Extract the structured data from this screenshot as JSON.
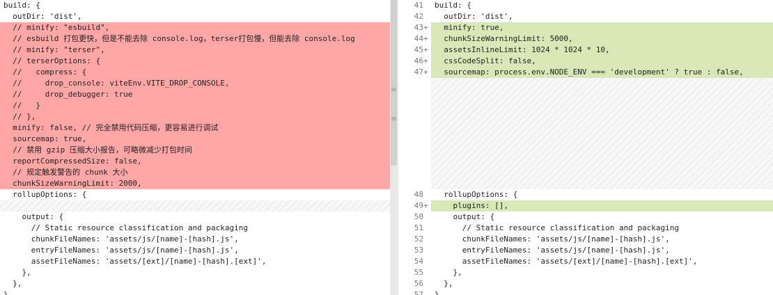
{
  "left": {
    "lines": [
      {
        "t": "build: {",
        "kind": "normal"
      },
      {
        "t": "  outDir: 'dist',",
        "kind": "normal"
      },
      {
        "t": "  // minify: \"esbuild\",",
        "kind": "del"
      },
      {
        "t": "  // esbuild 打包更快，但是不能去除 console.log，terser打包慢，但能去除 console.log",
        "kind": "del"
      },
      {
        "t": "  // minify: \"terser\",",
        "kind": "del"
      },
      {
        "t": "  // terserOptions: {",
        "kind": "del"
      },
      {
        "t": "  //   compress: {",
        "kind": "del"
      },
      {
        "t": "  //     drop_console: viteEnv.VITE_DROP_CONSOLE,",
        "kind": "del"
      },
      {
        "t": "  //     drop_debugger: true",
        "kind": "del"
      },
      {
        "t": "  //   }",
        "kind": "del"
      },
      {
        "t": "  // },",
        "kind": "del"
      },
      {
        "t": "  minify: false, // 完全禁用代码压缩，更容易进行调试",
        "kind": "del"
      },
      {
        "t": "  sourcemap: true,",
        "kind": "del"
      },
      {
        "t": "  // 禁用 gzip 压缩大小报告，可略微减少打包时间",
        "kind": "del"
      },
      {
        "t": "  reportCompressedSize: false,",
        "kind": "del"
      },
      {
        "t": "  // 规定触发警告的 chunk 大小",
        "kind": "del"
      },
      {
        "t": "  chunkSizeWarningLimit: 2000,",
        "kind": "del"
      },
      {
        "t": "  rollupOptions: {",
        "kind": "normal"
      },
      {
        "t": "",
        "kind": "ghost"
      },
      {
        "t": "    output: {",
        "kind": "normal"
      },
      {
        "t": "      // Static resource classification and packaging",
        "kind": "normal"
      },
      {
        "t": "      chunkFileNames: 'assets/js/[name]-[hash].js',",
        "kind": "normal"
      },
      {
        "t": "      entryFileNames: 'assets/js/[name]-[hash].js',",
        "kind": "normal"
      },
      {
        "t": "      assetFileNames: 'assets/[ext]/[name]-[hash].[ext]',",
        "kind": "normal"
      },
      {
        "t": "    },",
        "kind": "normal"
      },
      {
        "t": "  },",
        "kind": "normal"
      },
      {
        "t": "},",
        "kind": "normal"
      }
    ]
  },
  "right": {
    "lines": [
      {
        "n": "41",
        "pm": "",
        "t": "build: {",
        "kind": "normal"
      },
      {
        "n": "42",
        "pm": "",
        "t": "  outDir: 'dist',",
        "kind": "normal"
      },
      {
        "n": "43",
        "pm": "+",
        "t": "  minify: true,",
        "kind": "add"
      },
      {
        "n": "44",
        "pm": "+",
        "t": "  chunkSizeWarningLimit: 5000,",
        "kind": "add"
      },
      {
        "n": "45",
        "pm": "+",
        "t": "  assetsInlineLimit: 1024 * 1024 * 10,",
        "kind": "add"
      },
      {
        "n": "46",
        "pm": "+",
        "t": "  cssCodeSplit: false,",
        "kind": "add"
      },
      {
        "n": "47",
        "pm": "+",
        "t": "  sourcemap: process.env.NODE_ENV === 'development' ? true : false,",
        "kind": "add"
      },
      {
        "n": "",
        "pm": "",
        "t": "",
        "kind": "ghostblock"
      },
      {
        "n": "48",
        "pm": "",
        "t": "  rollupOptions: {",
        "kind": "normal"
      },
      {
        "n": "49",
        "pm": "+",
        "t": "    plugins: [],",
        "kind": "add"
      },
      {
        "n": "50",
        "pm": "",
        "t": "    output: {",
        "kind": "normal"
      },
      {
        "n": "51",
        "pm": "",
        "t": "      // Static resource classification and packaging",
        "kind": "normal"
      },
      {
        "n": "52",
        "pm": "",
        "t": "      chunkFileNames: 'assets/js/[name]-[hash].js',",
        "kind": "normal"
      },
      {
        "n": "53",
        "pm": "",
        "t": "      entryFileNames: 'assets/js/[name]-[hash].js',",
        "kind": "normal"
      },
      {
        "n": "54",
        "pm": "",
        "t": "      assetFileNames: 'assets/[ext]/[name]-[hash].[ext]',",
        "kind": "normal"
      },
      {
        "n": "55",
        "pm": "",
        "t": "    },",
        "kind": "normal"
      },
      {
        "n": "56",
        "pm": "",
        "t": "  },",
        "kind": "normal"
      },
      {
        "n": "57",
        "pm": "",
        "t": "},",
        "kind": "normal"
      }
    ]
  }
}
